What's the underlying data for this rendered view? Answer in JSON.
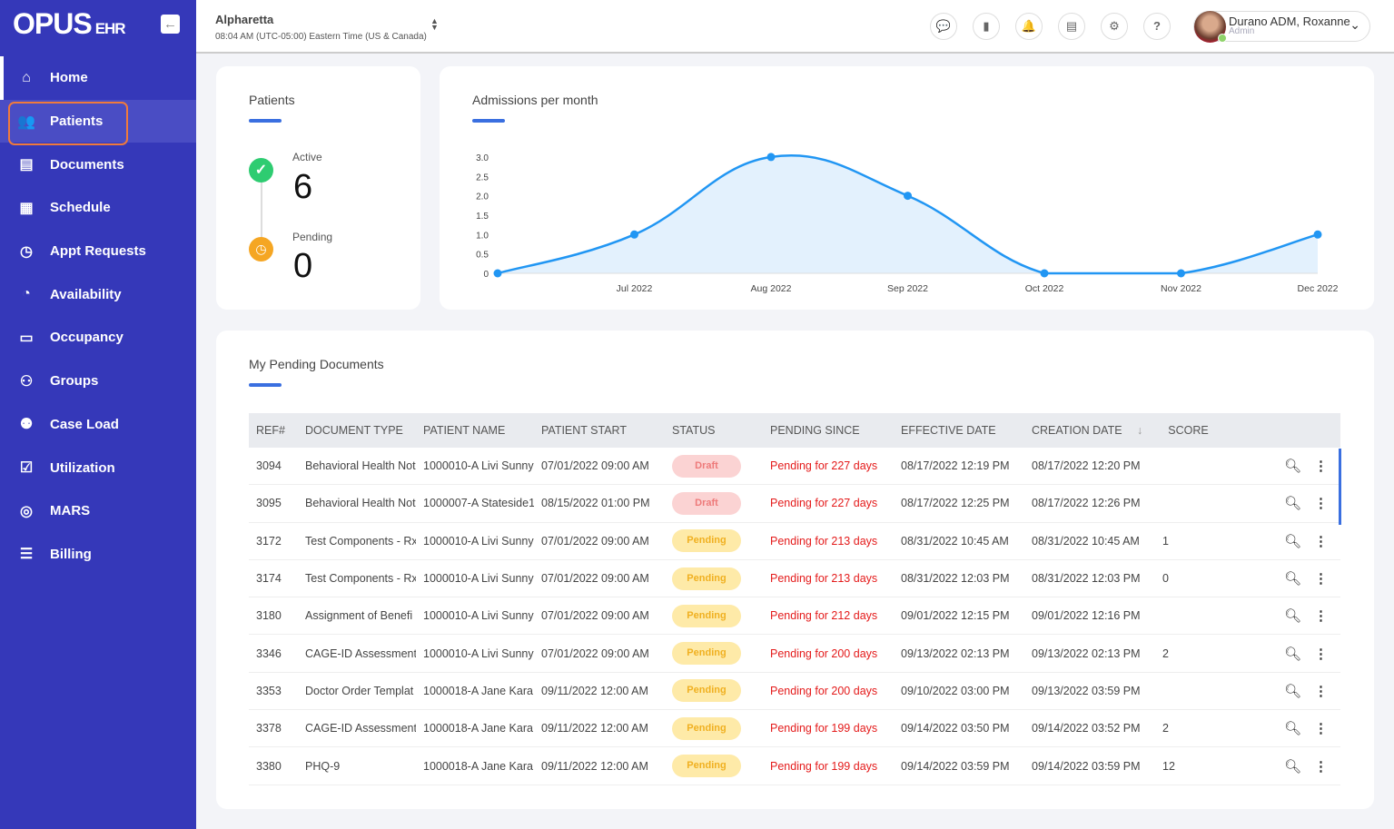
{
  "app": {
    "logo": "OPUS",
    "logo_suffix": "EHR"
  },
  "sidebar": {
    "items": [
      {
        "label": "Home",
        "icon": "home-icon"
      },
      {
        "label": "Patients",
        "icon": "users-icon"
      },
      {
        "label": "Documents",
        "icon": "documents-icon"
      },
      {
        "label": "Schedule",
        "icon": "calendar-icon"
      },
      {
        "label": "Appt Requests",
        "icon": "clock-icon"
      },
      {
        "label": "Availability",
        "icon": "availability-icon"
      },
      {
        "label": "Occupancy",
        "icon": "bed-icon"
      },
      {
        "label": "Groups",
        "icon": "groups-icon"
      },
      {
        "label": "Case Load",
        "icon": "case-load-icon"
      },
      {
        "label": "Utilization",
        "icon": "clipboard-icon"
      },
      {
        "label": "MARS",
        "icon": "pills-icon"
      },
      {
        "label": "Billing",
        "icon": "billing-icon"
      }
    ]
  },
  "header": {
    "location": "Alpharetta",
    "time": "08:04 AM (UTC-05:00) Eastern Time (US & Canada)",
    "user_name": "Durano ADM, Roxanne",
    "user_role": "Admin"
  },
  "patients": {
    "title": "Patients",
    "active_label": "Active",
    "active_value": "6",
    "pending_label": "Pending",
    "pending_value": "0"
  },
  "colors": {
    "sidebar": "#3538b9",
    "accent": "#3a6fe0",
    "line": "#2196f3"
  },
  "chart_data": {
    "type": "area",
    "title": "Admissions per month",
    "categories": [
      "",
      "Jul 2022",
      "Aug 2022",
      "Sep 2022",
      "Oct 2022",
      "Nov 2022",
      "Dec 2022"
    ],
    "values": [
      0,
      1,
      3,
      2,
      0,
      0,
      1
    ],
    "ylim": [
      0,
      3
    ],
    "yticks": [
      "0",
      "0.5",
      "1.0",
      "1.5",
      "2.0",
      "2.5",
      "3.0"
    ],
    "grid": false
  },
  "documents": {
    "title": "My Pending Documents",
    "columns": [
      "REF#",
      "DOCUMENT TYPE",
      "PATIENT NAME",
      "PATIENT START",
      "STATUS",
      "PENDING SINCE",
      "EFFECTIVE DATE",
      "CREATION DATE",
      "SCORE"
    ],
    "rows": [
      [
        "3094",
        "Behavioral Health Not",
        "1000010-A Livi Sunny",
        "07/01/2022 09:00 AM",
        "Draft",
        "Pending for 227 days",
        "08/17/2022 12:19 PM",
        "08/17/2022 12:20 PM",
        ""
      ],
      [
        "3095",
        "Behavioral Health Not",
        "1000007-A Stateside1",
        "08/15/2022 01:00 PM",
        "Draft",
        "Pending for 227 days",
        "08/17/2022 12:25 PM",
        "08/17/2022 12:26 PM",
        ""
      ],
      [
        "3172",
        "Test Components - Rx",
        "1000010-A Livi Sunny",
        "07/01/2022 09:00 AM",
        "Pending",
        "Pending for 213 days",
        "08/31/2022 10:45 AM",
        "08/31/2022 10:45 AM",
        "1"
      ],
      [
        "3174",
        "Test Components - Rx",
        "1000010-A Livi Sunny",
        "07/01/2022 09:00 AM",
        "Pending",
        "Pending for 213 days",
        "08/31/2022 12:03 PM",
        "08/31/2022 12:03 PM",
        "0"
      ],
      [
        "3180",
        "Assignment of Benefi",
        "1000010-A Livi Sunny",
        "07/01/2022 09:00 AM",
        "Pending",
        "Pending for 212 days",
        "09/01/2022 12:15 PM",
        "09/01/2022 12:16 PM",
        ""
      ],
      [
        "3346",
        "CAGE-ID Assessment",
        "1000010-A Livi Sunny",
        "07/01/2022 09:00 AM",
        "Pending",
        "Pending for 200 days",
        "09/13/2022 02:13 PM",
        "09/13/2022 02:13 PM",
        "2"
      ],
      [
        "3353",
        "Doctor Order Templat",
        "1000018-A Jane Kara",
        "09/11/2022 12:00 AM",
        "Pending",
        "Pending for 200 days",
        "09/10/2022 03:00 PM",
        "09/13/2022 03:59 PM",
        ""
      ],
      [
        "3378",
        "CAGE-ID Assessment",
        "1000018-A Jane Kara",
        "09/11/2022 12:00 AM",
        "Pending",
        "Pending for 199 days",
        "09/14/2022 03:50 PM",
        "09/14/2022 03:52 PM",
        "2"
      ],
      [
        "3380",
        "PHQ-9",
        "1000018-A Jane Kara",
        "09/11/2022 12:00 AM",
        "Pending",
        "Pending for 199 days",
        "09/14/2022 03:59 PM",
        "09/14/2022 03:59 PM",
        "12"
      ]
    ]
  }
}
